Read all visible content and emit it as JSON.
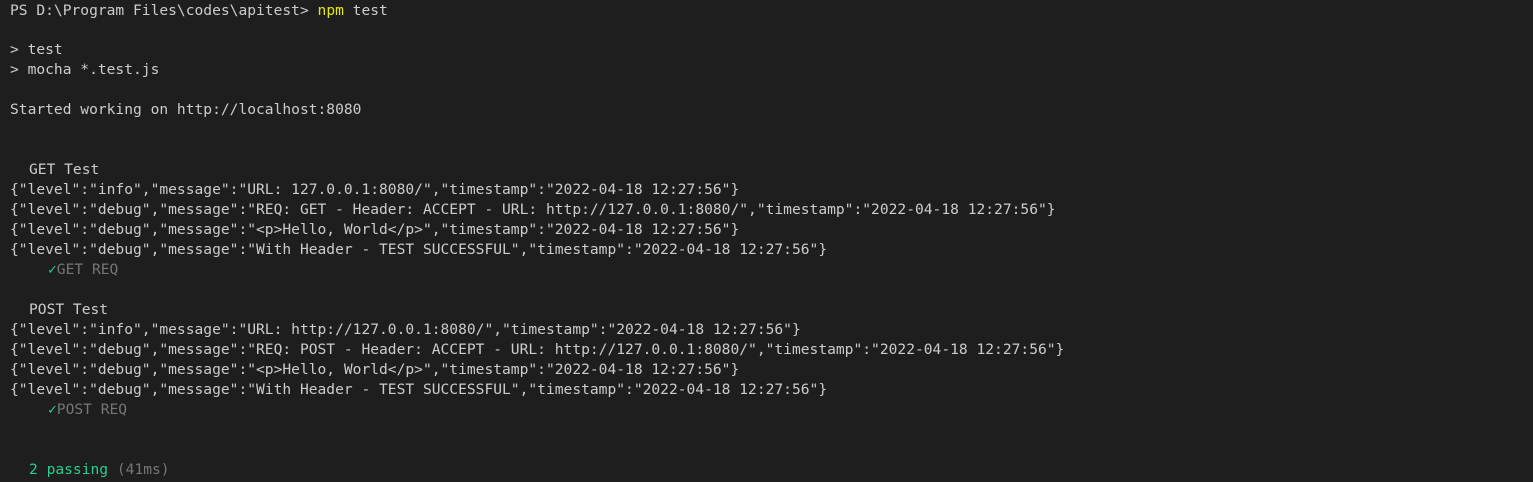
{
  "prompt": {
    "prefix": "PS D:\\Program Files\\codes\\apitest> ",
    "command": "npm",
    "args": " test"
  },
  "script_lines": [
    "> test",
    "> mocha *.test.js"
  ],
  "server_message": "Started working on http://localhost:8080",
  "suites": [
    {
      "title": "GET Test",
      "logs": [
        "{\"level\":\"info\",\"message\":\"URL: 127.0.0.1:8080/\",\"timestamp\":\"2022-04-18 12:27:56\"}",
        "{\"level\":\"debug\",\"message\":\"REQ: GET - Header: ACCEPT - URL: http://127.0.0.1:8080/\",\"timestamp\":\"2022-04-18 12:27:56\"}",
        "{\"level\":\"debug\",\"message\":\"<p>Hello, World</p>\",\"timestamp\":\"2022-04-18 12:27:56\"}",
        "{\"level\":\"debug\",\"message\":\"With Header - TEST SUCCESSFUL\",\"timestamp\":\"2022-04-18 12:27:56\"}"
      ],
      "result_mark": "✓",
      "result": "GET REQ"
    },
    {
      "title": "POST Test",
      "logs": [
        "{\"level\":\"info\",\"message\":\"URL: http://127.0.0.1:8080/\",\"timestamp\":\"2022-04-18 12:27:56\"}",
        "{\"level\":\"debug\",\"message\":\"REQ: POST - Header: ACCEPT - URL: http://127.0.0.1:8080/\",\"timestamp\":\"2022-04-18 12:27:56\"}",
        "{\"level\":\"debug\",\"message\":\"<p>Hello, World</p>\",\"timestamp\":\"2022-04-18 12:27:56\"}",
        "{\"level\":\"debug\",\"message\":\"With Header - TEST SUCCESSFUL\",\"timestamp\":\"2022-04-18 12:27:56\"}"
      ],
      "result_mark": "✓",
      "result": "POST REQ"
    }
  ],
  "summary": {
    "passing": "2 passing",
    "duration": "(41ms)"
  },
  "colors": {
    "background": "#1e1e1e",
    "text": "#cccccc",
    "command": "#e5e510",
    "success": "#23d18b",
    "dim": "#767676"
  }
}
